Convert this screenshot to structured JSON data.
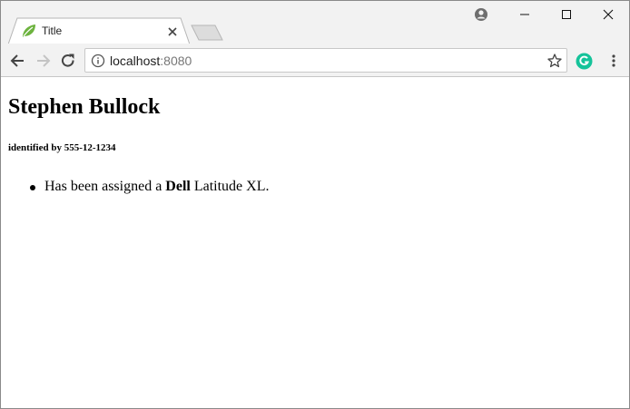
{
  "browser": {
    "tab": {
      "title": "Title",
      "favicon": "spring-leaf-icon"
    },
    "address": {
      "host": "localhost",
      "port": ":8080"
    },
    "icons": {
      "account": "account-circle-icon",
      "back": "arrow-left-icon",
      "forward": "arrow-right-icon",
      "reload": "reload-icon",
      "info": "info-circle-icon",
      "star": "star-outline-icon",
      "extension": "grammarly-icon",
      "menu": "vertical-dots-icon",
      "minimize": "minimize-icon",
      "maximize": "maximize-icon",
      "close": "close-icon"
    },
    "colors": {
      "chrome": "#f2f2f2",
      "extension_green": "#15c39a"
    }
  },
  "page": {
    "name": "Stephen Bullock",
    "identified_prefix": "identified by",
    "identifier": "555-12-1234",
    "assignments": [
      {
        "prefix": "Has been assigned a",
        "brand": "Dell",
        "model": "Latitude XL."
      }
    ]
  }
}
